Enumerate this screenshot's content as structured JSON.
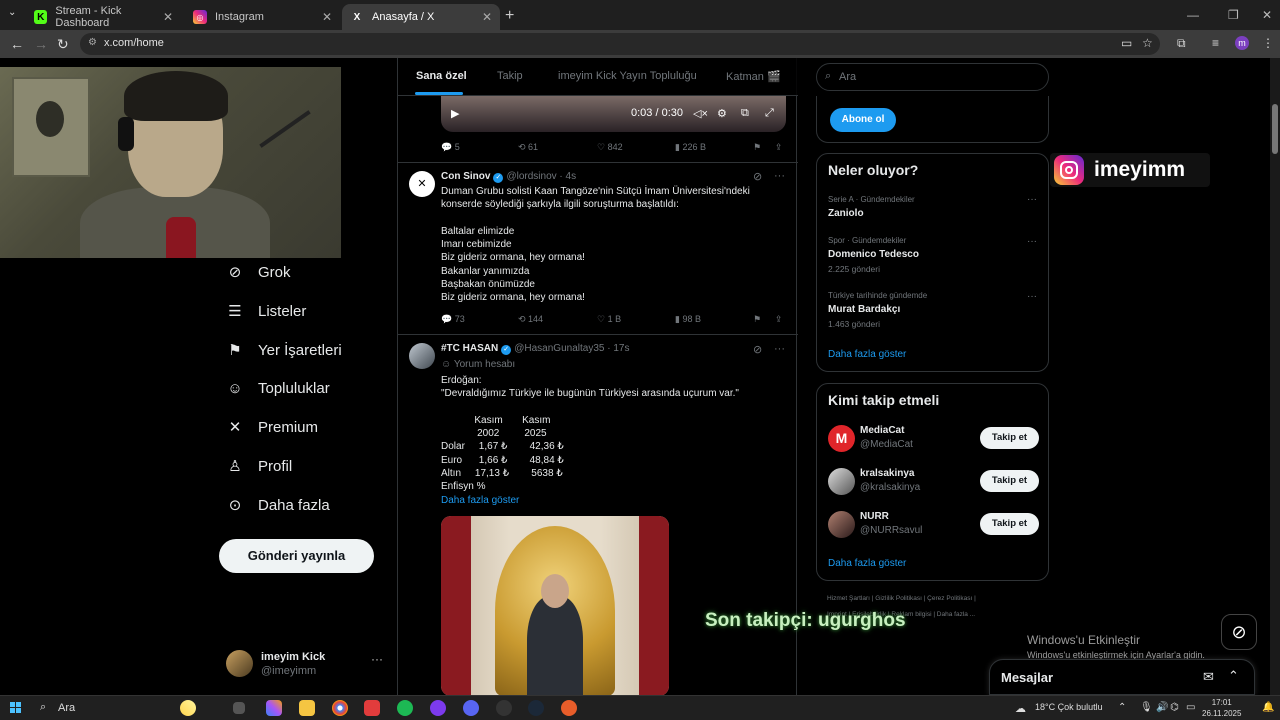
{
  "browser": {
    "tabs": [
      {
        "title": "Stream - Kick Dashboard",
        "favicon": "K",
        "color": "#53fc18"
      },
      {
        "title": "Instagram",
        "favicon": "ig",
        "color": "#e1306c"
      },
      {
        "title": "Anasayfa / X",
        "favicon": "X",
        "color": "#000000"
      }
    ],
    "url": "x.com/home",
    "profile_initial": "m"
  },
  "sidebar": {
    "items": [
      {
        "label": "Grok",
        "icon": "grok-icon"
      },
      {
        "label": "Listeler",
        "icon": "list-icon"
      },
      {
        "label": "Yer İşaretleri",
        "icon": "bookmark-icon"
      },
      {
        "label": "Topluluklar",
        "icon": "communities-icon"
      },
      {
        "label": "Premium",
        "icon": "x-logo-icon"
      },
      {
        "label": "Profil",
        "icon": "profile-icon"
      },
      {
        "label": "Daha fazla",
        "icon": "more-circle-icon"
      }
    ],
    "post_button": "Gönderi yayınla",
    "account": {
      "name": "imeyim Kick",
      "handle": "@imeyimm"
    }
  },
  "timeline": {
    "tabs": [
      "Sana özel",
      "Takip",
      "imeyim Kick Yayın Topluluğu",
      "Katman 🎬"
    ],
    "video": {
      "time": "0:03 / 0:30"
    },
    "first_actions": {
      "replies": "5",
      "reposts": "61",
      "likes": "842",
      "views": "226 B"
    },
    "tweets": [
      {
        "name": "Con Sinov",
        "handle": "@lordsinov · 4s",
        "lines": [
          "Duman Grubu solisti Kaan Tangöze'nin Sütçü İmam Üniversitesi'ndeki",
          "konserde söylediği şarkıyla ilgili soruşturma başlatıldı:",
          "",
          "Baltalar elimizde",
          "Imarı cebimizde",
          "Biz gideriz ormana, hey ormana!",
          "Bakanlar yanımızda",
          "Başbakan önümüzde",
          "Biz gideriz ormana, hey ormana!"
        ],
        "replies": "73",
        "reposts": "144",
        "likes": "1 B",
        "views": "98 B"
      },
      {
        "name": "#TC HASAN",
        "handle": "@HasanGunaltay35 · 17s",
        "sub": "Yorum hesabı",
        "lines": [
          "Erdoğan:",
          "\"Devraldığımız Türkiye ile bugünün Türkiyesi arasında uçurum var.\"",
          "",
          "            Kasım       Kasım",
          "             2002         2025",
          "Dolar     1,67 ₺        42,36 ₺",
          "Euro      1,66 ₺        48,84 ₺",
          "Altın     17,13 ₺        5638 ₺",
          "Enfisyn %"
        ],
        "show_more": "Daha fazla göster"
      }
    ]
  },
  "right": {
    "search_placeholder": "Ara",
    "subscribe": "Abone ol",
    "trends_title": "Neler oluyor?",
    "trends": [
      {
        "category": "Serie A · Gündemdekiler",
        "name": "Zaniolo",
        "count": ""
      },
      {
        "category": "Spor · Gündemdekiler",
        "name": "Domenico Tedesco",
        "count": "2.225 gönderi"
      },
      {
        "category": "Türkiye tarihinde gündemde",
        "name": "Murat Bardakçı",
        "count": "1.463 gönderi"
      }
    ],
    "show_more": "Daha fazla göster",
    "who_title": "Kimi takip etmeli",
    "who": [
      {
        "name": "MediaCat",
        "handle": "@MediaCat",
        "color": "#e0252a"
      },
      {
        "name": "kralsakinya",
        "handle": "@kralsakinya",
        "color": "#888888"
      },
      {
        "name": "NURR",
        "handle": "@NURRsavul",
        "color": "#6a3a3a"
      }
    ],
    "follow_label": "Takip et",
    "footer1": "Hizmet Şartları  |  Gizlilik Politikası  |  Çerez Politikası  |",
    "footer2": "Imprint  |  Erişilebilirlik  |  Reklam bilgisi  |  Daha fazla ...",
    "messages": "Mesajlar"
  },
  "overlay": {
    "instagram_name": "imeyimm",
    "last_follower": "Son takipçi: ugurghos",
    "activate_title": "Windows'u Etkinleştir",
    "activate_sub": "Windows'u etkinleştirmek için Ayarlar'a gidin."
  },
  "taskbar": {
    "search": "Ara",
    "weather": "18°C  Çok bulutlu",
    "time": "17:01",
    "date": "26.11.2025"
  }
}
